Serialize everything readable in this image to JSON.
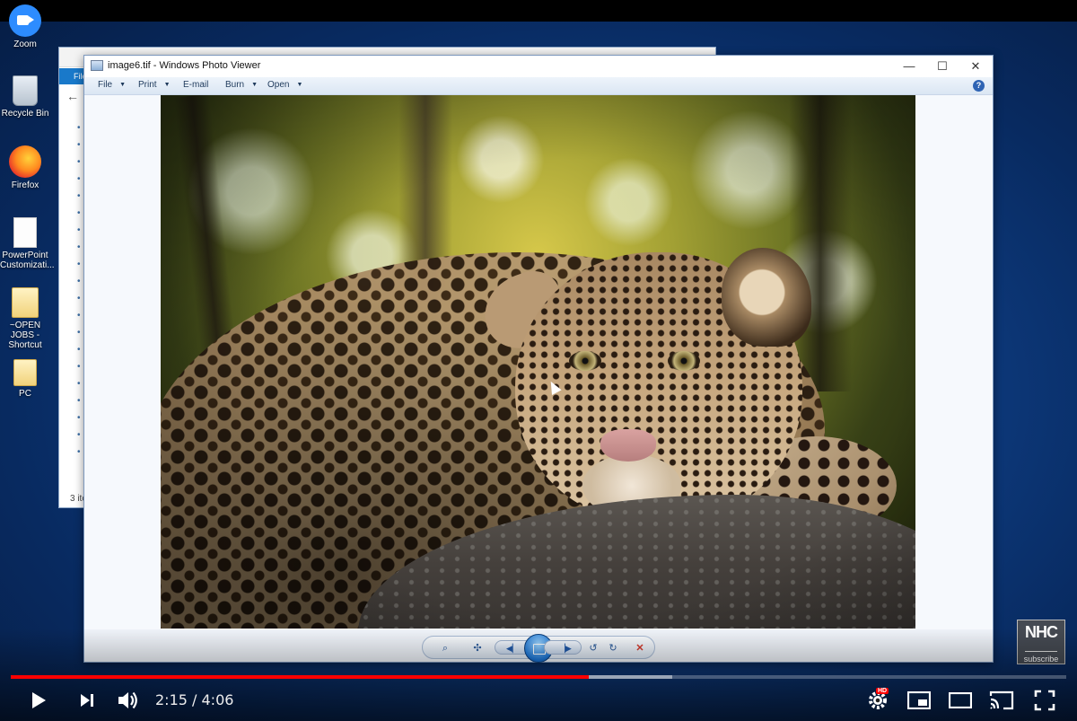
{
  "desktop": {
    "icons": [
      {
        "label": "Zoom",
        "icon": "zoom-icon"
      },
      {
        "label": "Recycle Bin",
        "icon": "recycle-bin-icon"
      },
      {
        "label": "Firefox",
        "icon": "firefox-icon"
      },
      {
        "label": "PowerPoint Customizati...",
        "icon": "document-icon"
      },
      {
        "label": "~OPEN JOBS - Shortcut",
        "icon": "folder-shortcut-icon"
      },
      {
        "label": "PC",
        "icon": "pc-icon"
      }
    ]
  },
  "explorer": {
    "ribbon_tab": "File",
    "status": "3 ite"
  },
  "photo_viewer": {
    "title": "image6.tif - Windows Photo Viewer",
    "menu": {
      "file": "File",
      "print": "Print",
      "email": "E-mail",
      "burn": "Burn",
      "open": "Open"
    },
    "controls": {
      "minimize": "—",
      "maximize": "☐",
      "close": "✕"
    }
  },
  "watermark": {
    "logo": "NHC",
    "subscribe": "subscribe"
  },
  "player": {
    "current_time": "2:15",
    "duration": "4:06",
    "time_display": "2:15 / 4:06",
    "played_fraction": 0.548,
    "buffered_fraction": 0.627,
    "hd_badge": "HD"
  },
  "colors": {
    "progress_played": "#ff0000",
    "desktop_blue": "#0f3f86",
    "viewer_frame": "#f0f4fa"
  }
}
